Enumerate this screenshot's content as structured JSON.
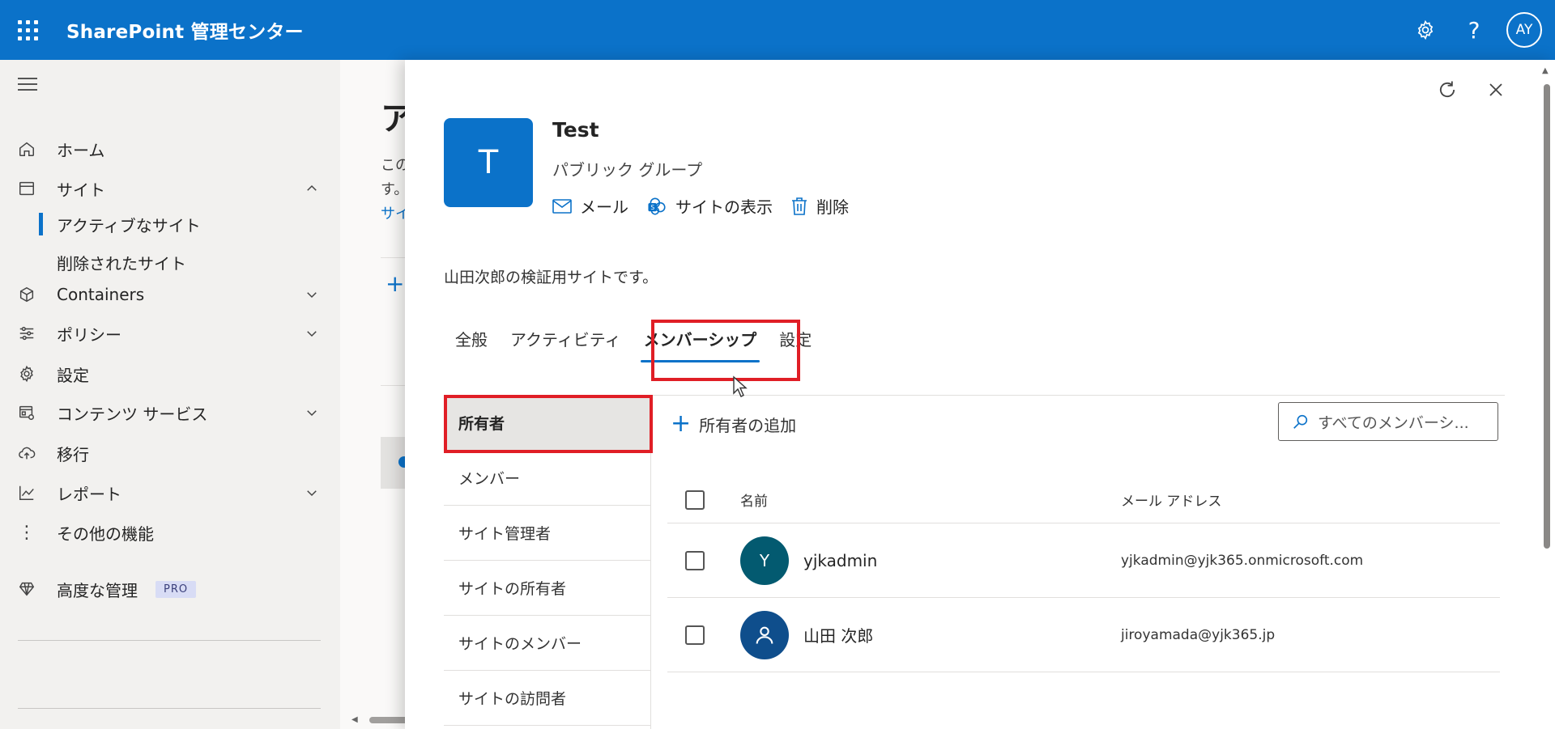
{
  "header": {
    "app_title": "SharePoint 管理センター",
    "avatar_initials": "AY",
    "brand_color": "#0b72c9"
  },
  "leftnav": {
    "items": [
      {
        "label": "ホーム",
        "icon": "home-icon"
      },
      {
        "label": "サイト",
        "icon": "browser-icon",
        "expanded": true
      },
      {
        "label": "Containers",
        "icon": "cube-icon"
      },
      {
        "label": "ポリシー",
        "icon": "sliders-icon"
      },
      {
        "label": "設定",
        "icon": "gear-icon"
      },
      {
        "label": "コンテンツ サービス",
        "icon": "content-services-icon"
      },
      {
        "label": "移行",
        "icon": "cloud-upload-icon"
      },
      {
        "label": "レポート",
        "icon": "chart-icon"
      },
      {
        "label": "その他の機能",
        "icon": "more-vertical-icon"
      },
      {
        "label": "高度な管理",
        "icon": "diamond-icon",
        "badge": "PRO"
      }
    ],
    "sub_items": [
      "アクティブなサイト",
      "削除されたサイト"
    ]
  },
  "background": {
    "heading": "ア",
    "text1": "この",
    "text2": "す。",
    "link": "サイ"
  },
  "panel": {
    "site_initial": "T",
    "site_title": "Test",
    "site_type": "パブリック グループ",
    "actions": [
      "メール",
      "サイトの表示",
      "削除"
    ],
    "description": "山田次郎の検証用サイトです。",
    "tabs": [
      "全般",
      "アクティビティ",
      "メンバーシップ",
      "設定"
    ],
    "active_tab": "メンバーシップ",
    "subnav": [
      "所有者",
      "メンバー",
      "サイト管理者",
      "サイトの所有者",
      "サイトのメンバー",
      "サイトの訪問者"
    ],
    "add_owner_label": "所有者の追加",
    "search_placeholder": "すべてのメンバーシ...",
    "table": {
      "headers": {
        "name": "名前",
        "email": "メール アドレス"
      },
      "rows": [
        {
          "initial": "Y",
          "name": "yjkadmin",
          "email": "yjkadmin@yjk365.onmicrosoft.com",
          "avatar_color": "#035a70",
          "avatar_type": "initial"
        },
        {
          "initial": "",
          "name": "山田 次郎",
          "email": "jiroyamada@yjk365.jp",
          "avatar_color": "#0f4e8c",
          "avatar_type": "person-icon"
        }
      ]
    }
  },
  "highlight_color": "#e01e26"
}
